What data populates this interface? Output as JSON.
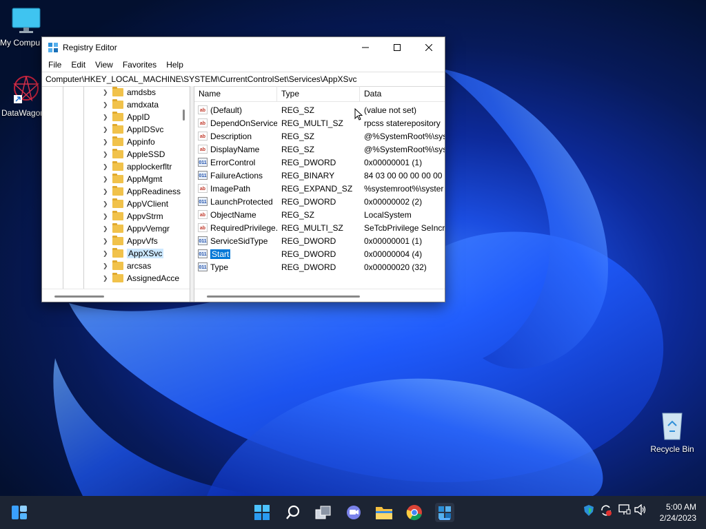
{
  "desktop": {
    "icons": [
      {
        "label": "My Compu"
      },
      {
        "label": "DataWagon"
      },
      {
        "label": "Recycle Bin"
      }
    ]
  },
  "window": {
    "title": "Registry Editor",
    "menu": [
      "File",
      "Edit",
      "View",
      "Favorites",
      "Help"
    ],
    "address": "Computer\\HKEY_LOCAL_MACHINE\\SYSTEM\\CurrentControlSet\\Services\\AppXSvc",
    "tree": {
      "items": [
        {
          "label": "amdsbs",
          "selected": false
        },
        {
          "label": "amdxata",
          "selected": false
        },
        {
          "label": "AppID",
          "selected": false
        },
        {
          "label": "AppIDSvc",
          "selected": false
        },
        {
          "label": "Appinfo",
          "selected": false
        },
        {
          "label": "AppleSSD",
          "selected": false
        },
        {
          "label": "applockerfltr",
          "selected": false
        },
        {
          "label": "AppMgmt",
          "selected": false
        },
        {
          "label": "AppReadiness",
          "selected": false
        },
        {
          "label": "AppVClient",
          "selected": false
        },
        {
          "label": "AppvStrm",
          "selected": false
        },
        {
          "label": "AppvVemgr",
          "selected": false
        },
        {
          "label": "AppvVfs",
          "selected": false
        },
        {
          "label": "AppXSvc",
          "selected": true
        },
        {
          "label": "arcsas",
          "selected": false
        },
        {
          "label": "AssignedAcce",
          "selected": false
        }
      ]
    },
    "list": {
      "columns": [
        "Name",
        "Type",
        "Data"
      ],
      "rows": [
        {
          "name": "(Default)",
          "type": "REG_SZ",
          "data": "(value not set)",
          "kind": "sz"
        },
        {
          "name": "DependOnService",
          "type": "REG_MULTI_SZ",
          "data": "rpcss staterepository",
          "kind": "sz"
        },
        {
          "name": "Description",
          "type": "REG_SZ",
          "data": "@%SystemRoot%\\sys",
          "kind": "sz"
        },
        {
          "name": "DisplayName",
          "type": "REG_SZ",
          "data": "@%SystemRoot%\\sys",
          "kind": "sz"
        },
        {
          "name": "ErrorControl",
          "type": "REG_DWORD",
          "data": "0x00000001 (1)",
          "kind": "bin"
        },
        {
          "name": "FailureActions",
          "type": "REG_BINARY",
          "data": "84 03 00 00 00 00 00 00",
          "kind": "bin"
        },
        {
          "name": "ImagePath",
          "type": "REG_EXPAND_SZ",
          "data": "%systemroot%\\syster",
          "kind": "sz"
        },
        {
          "name": "LaunchProtected",
          "type": "REG_DWORD",
          "data": "0x00000002 (2)",
          "kind": "bin"
        },
        {
          "name": "ObjectName",
          "type": "REG_SZ",
          "data": "LocalSystem",
          "kind": "sz"
        },
        {
          "name": "RequiredPrivilege...",
          "type": "REG_MULTI_SZ",
          "data": "SeTcbPrivilege SeIncre",
          "kind": "sz"
        },
        {
          "name": "ServiceSidType",
          "type": "REG_DWORD",
          "data": "0x00000001 (1)",
          "kind": "bin"
        },
        {
          "name": "Start",
          "type": "REG_DWORD",
          "data": "0x00000004 (4)",
          "kind": "bin",
          "selected": true
        },
        {
          "name": "Type",
          "type": "REG_DWORD",
          "data": "0x00000020 (32)",
          "kind": "bin"
        }
      ]
    }
  },
  "icon_glyphs": {
    "sz": "ab",
    "bin": "011"
  },
  "taskbar": {
    "icons": [
      "widgets-icon",
      "start-icon",
      "search-icon",
      "task-view-icon",
      "chat-icon",
      "file-explorer-icon",
      "chrome-icon",
      "registry-editor-icon"
    ],
    "clock": {
      "time": "5:00 AM",
      "date": "2/24/2023"
    }
  },
  "colors": {
    "accent": "#0078d7",
    "taskbar": "#1c2433"
  }
}
